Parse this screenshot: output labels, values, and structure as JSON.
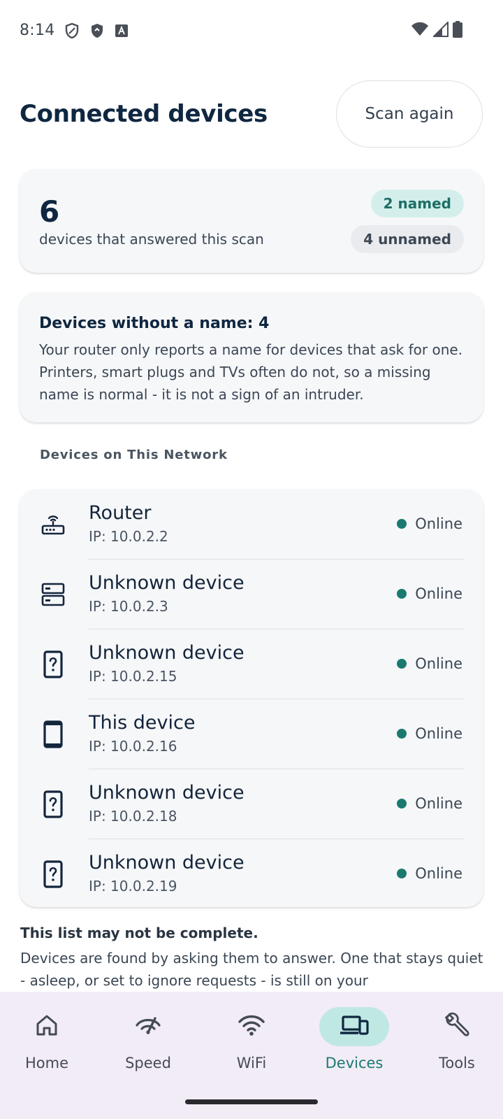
{
  "status_bar": {
    "time": "8:14",
    "icons": [
      "shield-outline-icon",
      "shield-filled-icon",
      "font-a-icon",
      "wifi-icon",
      "signal-icon",
      "battery-icon"
    ]
  },
  "header": {
    "title": "Connected devices",
    "scan_button_label": "Scan again"
  },
  "summary": {
    "count": "6",
    "subtitle": "devices that answered this scan",
    "named_badge": "2 named",
    "unnamed_badge": "4 unnamed"
  },
  "info_card": {
    "title": "Devices without a name: 4",
    "body": "Your router only reports a name for devices that ask for one. Printers, smart plugs and TVs often do not, so a missing name is normal - it is not a sign of an intruder."
  },
  "section_label": "Devices on This Network",
  "devices": [
    {
      "name": "Router",
      "ip": "IP: 10.0.2.2",
      "status": "Online",
      "icon": "router-icon"
    },
    {
      "name": "Unknown device",
      "ip": "IP: 10.0.2.3",
      "status": "Online",
      "icon": "server-icon"
    },
    {
      "name": "Unknown device",
      "ip": "IP: 10.0.2.15",
      "status": "Online",
      "icon": "device-unknown-icon"
    },
    {
      "name": "This device",
      "ip": "IP: 10.0.2.16",
      "status": "Online",
      "icon": "phone-icon"
    },
    {
      "name": "Unknown device",
      "ip": "IP: 10.0.2.18",
      "status": "Online",
      "icon": "device-unknown-icon"
    },
    {
      "name": "Unknown device",
      "ip": "IP: 10.0.2.19",
      "status": "Online",
      "icon": "device-unknown-icon"
    }
  ],
  "note": {
    "title": "This list may not be complete.",
    "body": "Devices are found by asking them to answer. One that stays quiet - asleep, or set to ignore requests - is still on your"
  },
  "nav": {
    "items": [
      {
        "label": "Home",
        "icon": "home-icon",
        "active": false
      },
      {
        "label": "Speed",
        "icon": "speed-icon",
        "active": false
      },
      {
        "label": "WiFi",
        "icon": "wifi-icon",
        "active": false
      },
      {
        "label": "Devices",
        "icon": "devices-icon",
        "active": true
      },
      {
        "label": "Tools",
        "icon": "wrench-icon",
        "active": false
      }
    ]
  },
  "colors": {
    "accent": "#1b7a70",
    "accent_container": "#bfe8e3",
    "title_text": "#0f2740",
    "card_bg": "#f6f7f9",
    "nav_bg": "#f2ecf6"
  }
}
